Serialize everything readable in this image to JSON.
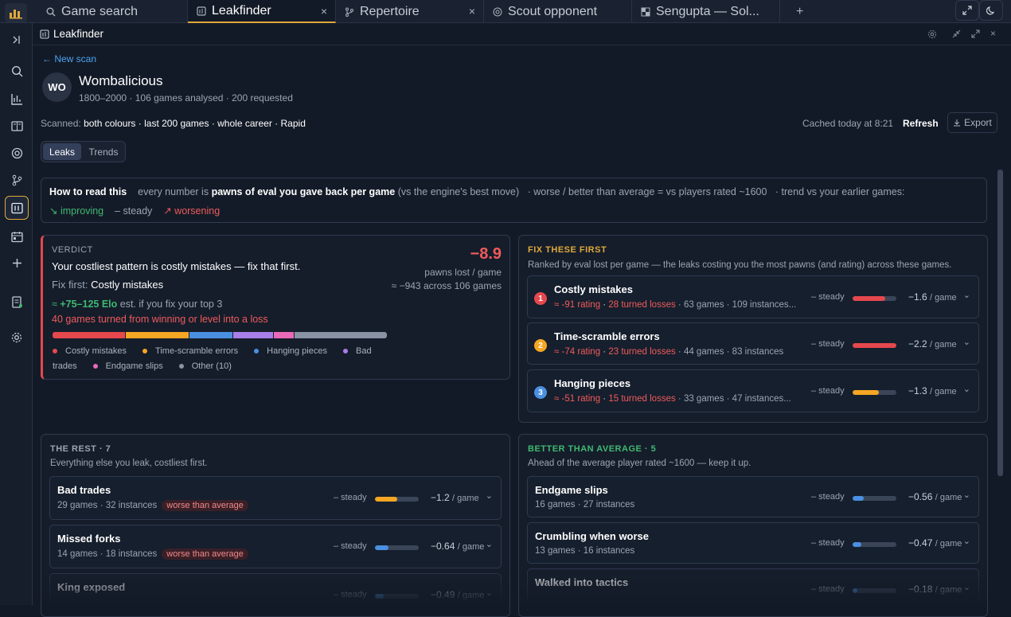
{
  "tabs": [
    {
      "label": "Game search",
      "icon": "search-icon"
    },
    {
      "label": "Leakfinder",
      "icon": "leakfinder-icon"
    },
    {
      "label": "Repertoire",
      "icon": "branch-icon"
    },
    {
      "label": "Scout opponent",
      "icon": "target-icon"
    },
    {
      "label": "Sengupta — Sol...",
      "icon": "board-icon"
    }
  ],
  "tab_add": "+",
  "close_glyph": "×",
  "panel": {
    "title": "Leakfinder"
  },
  "back_link": "← New scan",
  "player": {
    "initials": "WO",
    "name": "Wombalicious",
    "meta": "1800–2000 · 106 games analysed · 200 requested"
  },
  "scan": {
    "prefix": "Scanned:",
    "value": "both colours · last 200 games · whole career · Rapid",
    "cached": "Cached today at 8:21",
    "refresh": "Refresh",
    "export": "Export"
  },
  "view_tabs": [
    {
      "label": "Leaks"
    },
    {
      "label": "Trends"
    }
  ],
  "howto": {
    "label": "How to read this",
    "t1": "every number is",
    "t2": "pawns of eval you gave back per game",
    "t3": "(vs the engine's best move)",
    "t4": "·  worse / better than average = vs players rated ~1600",
    "t5": "· trend vs your earlier games:",
    "improving": "↘ improving",
    "steady": "– steady",
    "worsening": "↗ worsening"
  },
  "verdict": {
    "heading": "VERDICT",
    "line1": "Your costliest pattern is costly mistakes — fix that first.",
    "fix_prefix": "Fix first:",
    "fix_value": "Costly mistakes",
    "elo_prefix": "≈ ",
    "elo": "+75–125 Elo",
    "elo_suffix": " est. if you fix your top 3",
    "turned": "40 games turned from winning or level into a loss",
    "big": "−8.9",
    "big_label": "pawns lost / game",
    "total": "≈ −943 across 106 games",
    "segments": [
      {
        "name": "Costly mistakes",
        "value": 0.22,
        "color": "#e5484d"
      },
      {
        "name": "Time-scramble errors",
        "value": 0.19,
        "color": "#f5a623"
      },
      {
        "name": "Hanging pieces",
        "value": 0.13,
        "color": "#4a90e2"
      },
      {
        "name": "Bad trades",
        "value": 0.12,
        "color": "#a87ee8"
      },
      {
        "name": "Endgame slips",
        "value": 0.06,
        "color": "#e86ab8"
      },
      {
        "name": "Other (10)",
        "value": 0.28,
        "color": "#8a93a3"
      }
    ]
  },
  "fix": {
    "heading": "FIX THESE FIRST",
    "sub": "Ranked by eval lost per game — the leaks costing you the most pawns (and rating) across these games.",
    "items": [
      {
        "rank": "1",
        "rank_color": "#e5484d",
        "title": "Costly mistakes",
        "rating": "≈ -91 rating",
        "losses": "28 turned losses",
        "rest": "· 63 games · 109 instances...",
        "trend": "– steady",
        "bar": 0.75,
        "bar_color": "#e5484d",
        "value": "−1.6",
        "unit": "/ game"
      },
      {
        "rank": "2",
        "rank_color": "#f5a623",
        "title": "Time-scramble errors",
        "rating": "≈ -74 rating",
        "losses": "23 turned losses",
        "rest": "· 44 games · 83 instances",
        "trend": "– steady",
        "bar": 1.0,
        "bar_color": "#e5484d",
        "value": "−2.2",
        "unit": "/ game"
      },
      {
        "rank": "3",
        "rank_color": "#4a90e2",
        "title": "Hanging pieces",
        "rating": "≈ -51 rating",
        "losses": "15 turned losses",
        "rest": "· 33 games · 47 instances...",
        "trend": "– steady",
        "bar": 0.6,
        "bar_color": "#f5a623",
        "value": "−1.3",
        "unit": "/ game"
      }
    ]
  },
  "rest": {
    "heading": "THE REST · 7",
    "sub": "Everything else you leak, costliest first.",
    "items": [
      {
        "title": "Bad trades",
        "meta": "29 games · 32 instances",
        "badge": "worse than average",
        "trend": "– steady",
        "bar": 0.5,
        "bar_color": "#f5a623",
        "value": "−1.2",
        "unit": "/ game"
      },
      {
        "title": "Missed forks",
        "meta": "14 games · 18 instances",
        "badge": "worse than average",
        "trend": "– steady",
        "bar": 0.3,
        "bar_color": "#4a90e2",
        "value": "−0.64",
        "unit": "/ game"
      },
      {
        "title": "King exposed",
        "meta": "",
        "badge": "",
        "trend": "– steady",
        "bar": 0.2,
        "bar_color": "#4a90e2",
        "value": "−0.49",
        "unit": "/ game"
      }
    ]
  },
  "better": {
    "heading": "BETTER THAN AVERAGE · 5",
    "sub": "Ahead of the average player rated ~1600 — keep it up.",
    "items": [
      {
        "title": "Endgame slips",
        "meta": "16 games · 27 instances",
        "trend": "– steady",
        "bar": 0.25,
        "bar_color": "#4a90e2",
        "value": "−0.56",
        "unit": "/ game"
      },
      {
        "title": "Crumbling when worse",
        "meta": "13 games · 16 instances",
        "trend": "– steady",
        "bar": 0.2,
        "bar_color": "#4a90e2",
        "value": "−0.47",
        "unit": "/ game"
      },
      {
        "title": "Walked into tactics",
        "meta": "",
        "trend": "– steady",
        "bar": 0.1,
        "bar_color": "#4a90e2",
        "value": "−0.18",
        "unit": "/ game"
      }
    ]
  }
}
